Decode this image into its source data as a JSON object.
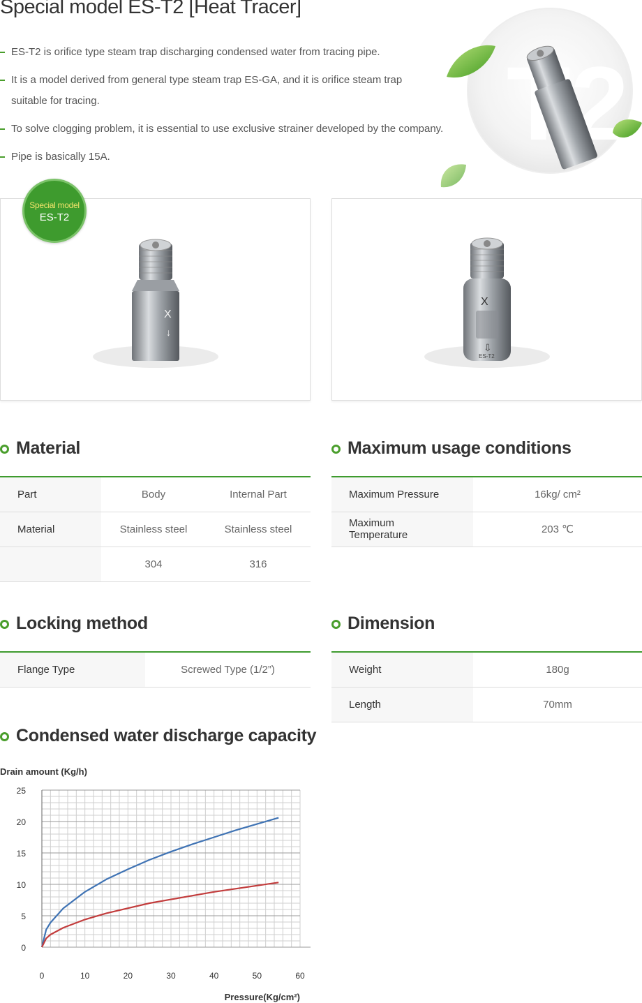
{
  "page": {
    "title": "Special model ES-T2 [Heat Tracer]",
    "bullets": [
      "ES-T2 is orifice type steam trap discharging condensed water from tracing pipe.",
      "It is a model derived from general type steam trap ES-GA, and it is orifice steam trap suitable for tracing.",
      "To solve clogging problem, it is essential to use exclusive strainer developed by the company.",
      "Pipe is basically 15A."
    ],
    "hero_text": "T2",
    "badge": {
      "line1": "Special model",
      "line2": "ES-T2"
    },
    "product_mark": "ES-T2"
  },
  "material": {
    "title": "Material",
    "rows": [
      [
        "Part",
        "Body",
        "Internal Part"
      ],
      [
        "Material",
        "Stainless steel",
        "Stainless steel"
      ],
      [
        "",
        "304",
        "316"
      ]
    ]
  },
  "conditions": {
    "title": "Maximum usage conditions",
    "rows": [
      [
        "Maximum Pressure",
        "16kg/ cm²"
      ],
      [
        "Maximum Temperature",
        "203 ℃"
      ]
    ]
  },
  "locking": {
    "title": "Locking method",
    "rows": [
      [
        "Flange Type",
        "Screwed Type (1/2”)"
      ]
    ]
  },
  "dimension": {
    "title": "Dimension",
    "rows": [
      [
        "Weight",
        "180g"
      ],
      [
        "Length",
        "70mm"
      ]
    ]
  },
  "capacity": {
    "title": "Condensed water discharge capacity"
  },
  "colors": {
    "accent": "#4a9e2c",
    "series_blue": "#3f73b4",
    "series_red": "#c23c3c",
    "badge_text": "#f1e36a"
  },
  "chart_data": {
    "type": "line",
    "ylabel": "Drain amount (Kg/h)",
    "xlabel": "Pressure(Kg/cm²)",
    "xlim": [
      0,
      60
    ],
    "ylim": [
      0,
      25
    ],
    "x_ticks": [
      0,
      10,
      20,
      30,
      40,
      50,
      60
    ],
    "y_ticks": [
      0,
      5,
      10,
      15,
      20,
      25
    ],
    "grid": true,
    "series": [
      {
        "color": "#3f73b4",
        "x": [
          0,
          1,
          2,
          5,
          10,
          15,
          20,
          25,
          30,
          35,
          40,
          45,
          50,
          55
        ],
        "y": [
          0,
          2.8,
          3.9,
          6.2,
          8.8,
          10.8,
          12.4,
          13.9,
          15.2,
          16.4,
          17.5,
          18.6,
          19.6,
          20.6
        ]
      },
      {
        "color": "#c23c3c",
        "x": [
          0,
          1,
          2,
          5,
          10,
          15,
          20,
          25,
          30,
          35,
          40,
          45,
          50,
          55
        ],
        "y": [
          0,
          1.4,
          2.0,
          3.1,
          4.4,
          5.4,
          6.2,
          7.0,
          7.6,
          8.2,
          8.8,
          9.3,
          9.8,
          10.3
        ]
      }
    ]
  }
}
